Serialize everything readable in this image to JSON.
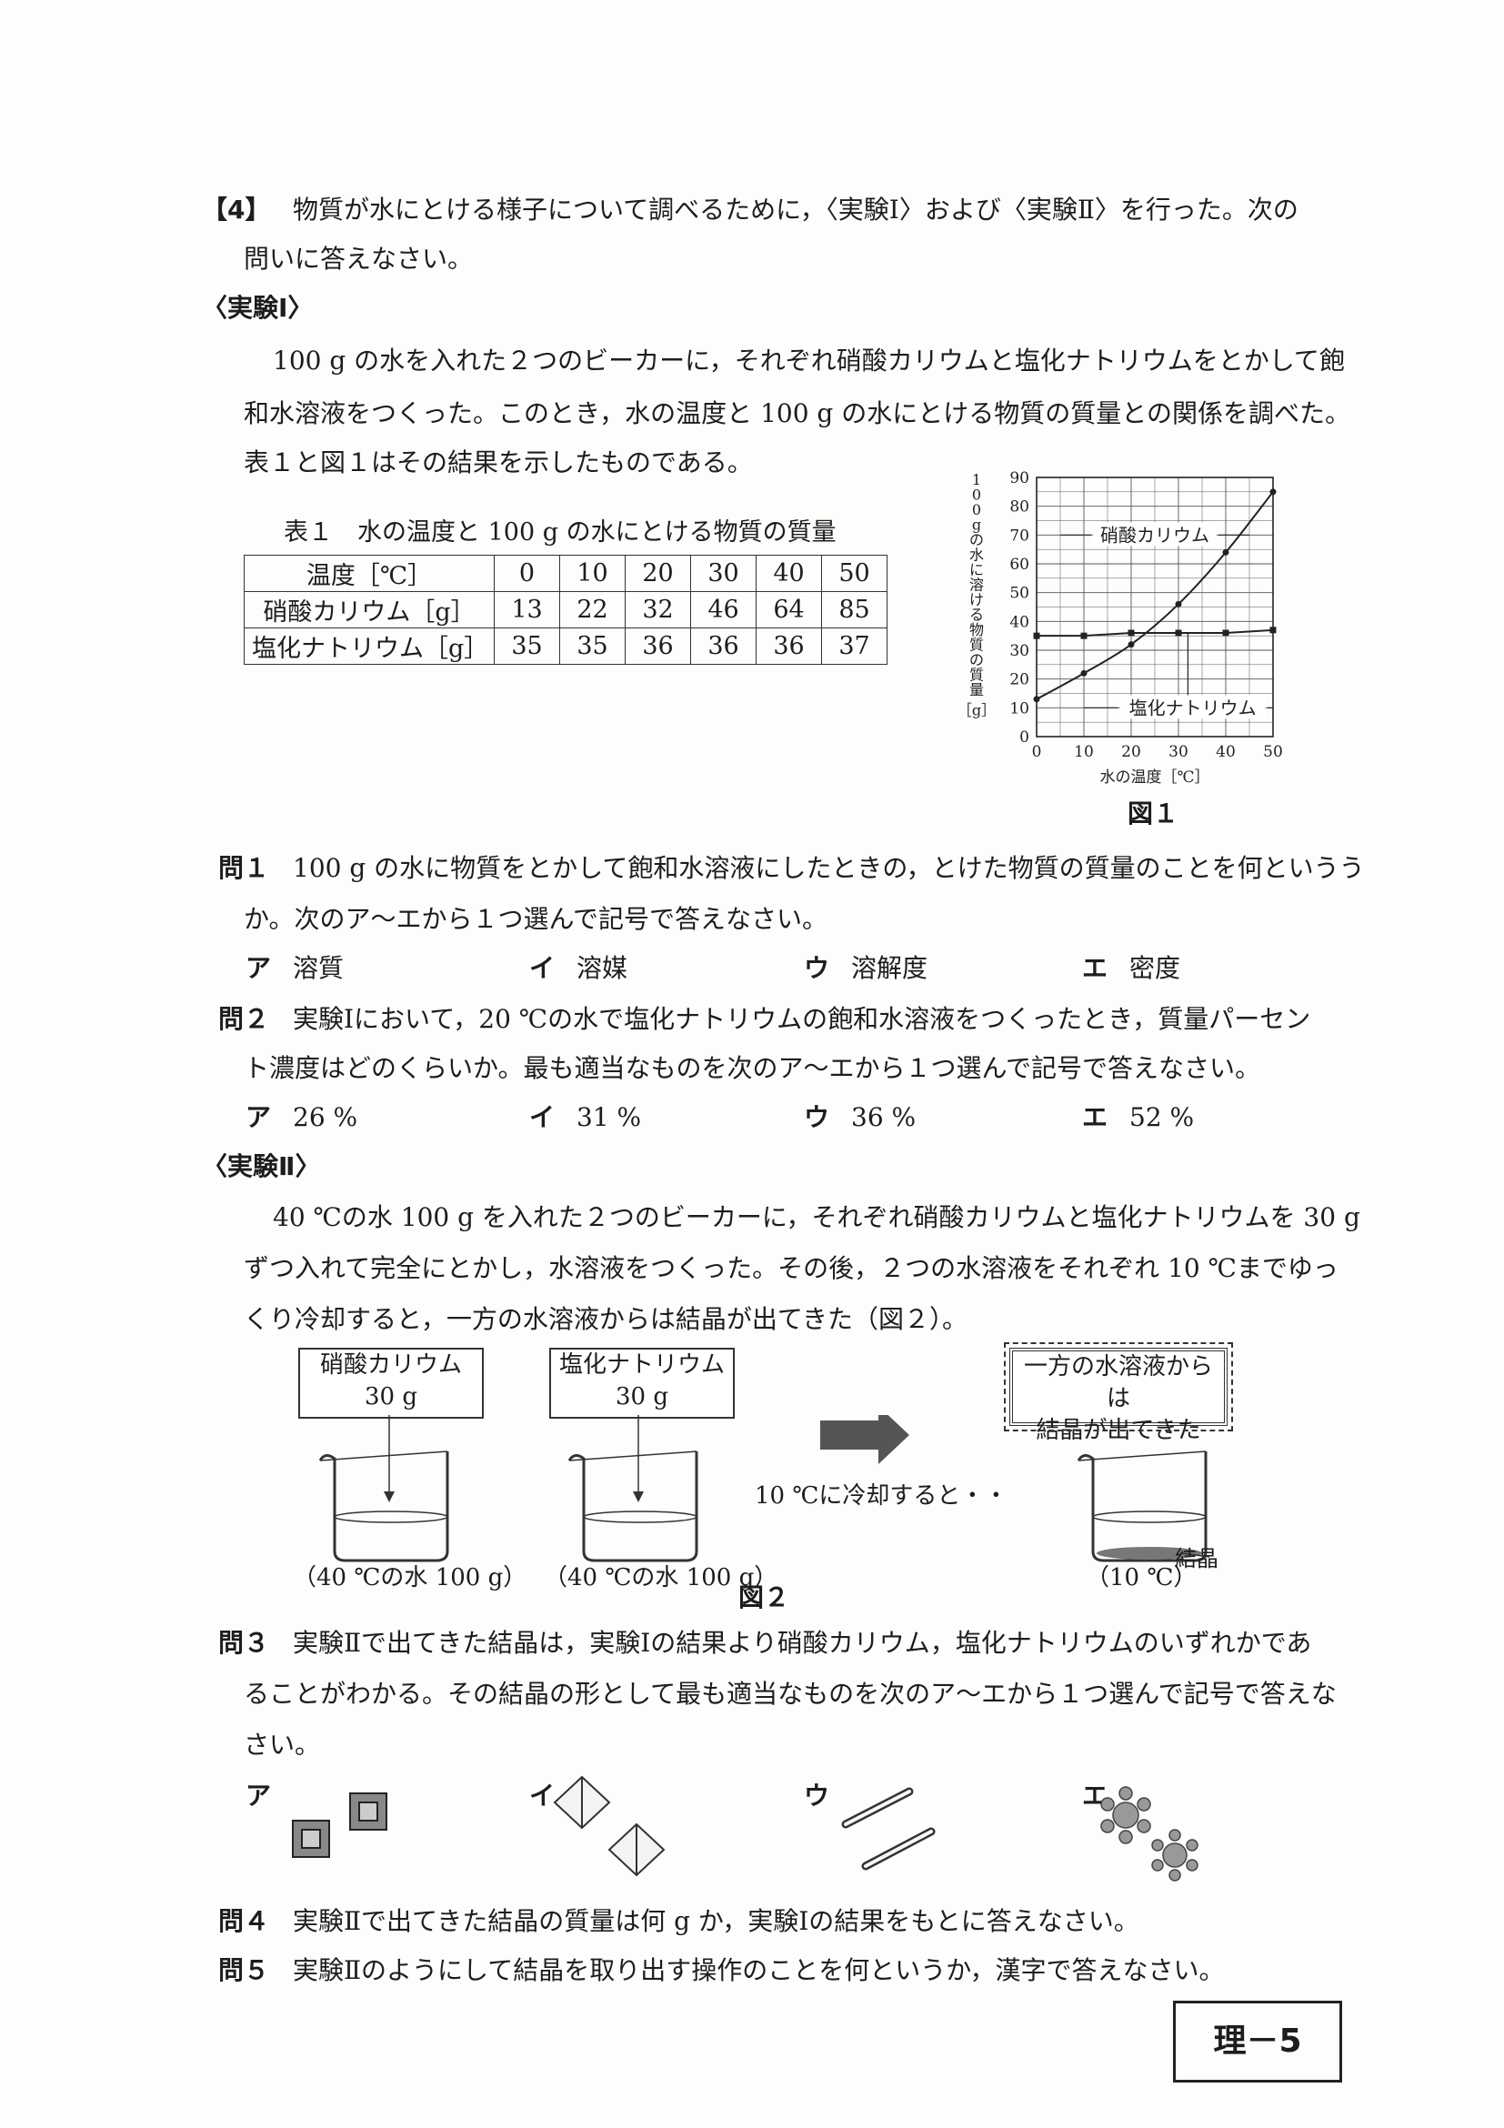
{
  "q4": {
    "num": "【4】",
    "intro_1": "物質が水にとける様子について調べるために，〈実験Ⅰ〉および〈実験Ⅱ〉を行った。次の",
    "intro_2": "問いに答えなさい。"
  },
  "exp1": {
    "heading": "〈実験Ⅰ〉",
    "p1": "100 g の水を入れた２つのビーカーに，それぞれ硝酸カリウムと塩化ナトリウムをとかして飽",
    "p2": "和水溶液をつくった。このとき，水の温度と 100 g の水にとける物質の質量との関係を調べた。",
    "p3": "表１と図１はその結果を示したものである。"
  },
  "table1": {
    "caption": "表１　水の温度と 100 g の水にとける物質の質量",
    "header_label": "温度［℃］",
    "temps": [
      "0",
      "10",
      "20",
      "30",
      "40",
      "50"
    ],
    "rows": [
      {
        "label": "硝酸カリウム［g］",
        "values": [
          "13",
          "22",
          "32",
          "46",
          "64",
          "85"
        ]
      },
      {
        "label": "塩化ナトリウム［g］",
        "values": [
          "35",
          "35",
          "36",
          "36",
          "36",
          "37"
        ]
      }
    ]
  },
  "chart_data": {
    "type": "line",
    "x": [
      0,
      10,
      20,
      30,
      40,
      50
    ],
    "series": [
      {
        "name": "硝酸カリウム",
        "values": [
          13,
          22,
          32,
          46,
          64,
          85
        ]
      },
      {
        "name": "塩化ナトリウム",
        "values": [
          35,
          35,
          36,
          36,
          36,
          37
        ]
      }
    ],
    "xlabel": "水の温度［℃］",
    "ylabel": "100gの水に溶ける物質の質量",
    "yunit": "［g］",
    "xlim": [
      0,
      50
    ],
    "ylim": [
      0,
      90
    ],
    "xticks": [
      "0",
      "10",
      "20",
      "30",
      "40",
      "50"
    ],
    "yticks": [
      "0",
      "10",
      "20",
      "30",
      "40",
      "50",
      "60",
      "70",
      "80",
      "90"
    ],
    "grid": true,
    "figure_label": "図１"
  },
  "q1": {
    "num": "問１",
    "text_1": "100 g の水に物質をとかして飽和水溶液にしたときの，とけた物質の質量のことを何というう",
    "text_2": "か。次のア～エから１つ選んで記号で答えなさい。",
    "choices": [
      {
        "key": "ア",
        "text": "溶質"
      },
      {
        "key": "イ",
        "text": "溶媒"
      },
      {
        "key": "ウ",
        "text": "溶解度"
      },
      {
        "key": "エ",
        "text": "密度"
      }
    ]
  },
  "q2": {
    "num": "問２",
    "text_1": "実験Ⅰにおいて，20 ℃の水で塩化ナトリウムの飽和水溶液をつくったとき，質量パーセン",
    "text_2": "ト濃度はどのくらいか。最も適当なものを次のア～エから１つ選んで記号で答えなさい。",
    "choices": [
      {
        "key": "ア",
        "text": "26 %"
      },
      {
        "key": "イ",
        "text": "31 %"
      },
      {
        "key": "ウ",
        "text": "36 %"
      },
      {
        "key": "エ",
        "text": "52 %"
      }
    ]
  },
  "exp2": {
    "heading": "〈実験Ⅱ〉",
    "p1": "40 ℃の水 100 g を入れた２つのビーカーに，それぞれ硝酸カリウムと塩化ナトリウムを 30 g",
    "p2": "ずつ入れて完全にとかし，水溶液をつくった。その後，２つの水溶液をそれぞれ 10 ℃までゆっ",
    "p3": "くり冷却すると，一方の水溶液からは結晶が出てきた（図２）。"
  },
  "fig2": {
    "box1_1": "硝酸カリウム",
    "box1_2": "30 g",
    "box2_1": "塩化ナトリウム",
    "box2_2": "30 g",
    "beaker1_label": "（40 ℃の水 100 g）",
    "beaker2_label": "（40 ℃の水 100 g）",
    "cool_text": "10 ℃に冷却すると・・",
    "result_1": "一方の水溶液からは",
    "result_2": "結晶が出てきた",
    "crystal_label": "結晶",
    "beaker3_label": "（10 ℃）",
    "figure_label": "図２"
  },
  "q3": {
    "num": "問３",
    "text_1": "実験Ⅱで出てきた結晶は，実験Ⅰの結果より硝酸カリウム，塩化ナトリウムのいずれかであ",
    "text_2": "ることがわかる。その結晶の形として最も適当なものを次のア～エから１つ選んで記号で答えな",
    "text_3": "さい。",
    "choices": [
      "ア",
      "イ",
      "ウ",
      "エ"
    ]
  },
  "q4q": {
    "num": "問４",
    "text": "実験Ⅱで出てきた結晶の質量は何 g か，実験Ⅰの結果をもとに答えなさい。"
  },
  "q5": {
    "num": "問５",
    "text": "実験Ⅱのようにして結晶を取り出す操作のことを何というか，漢字で答えなさい。"
  },
  "page_label": "理－5"
}
